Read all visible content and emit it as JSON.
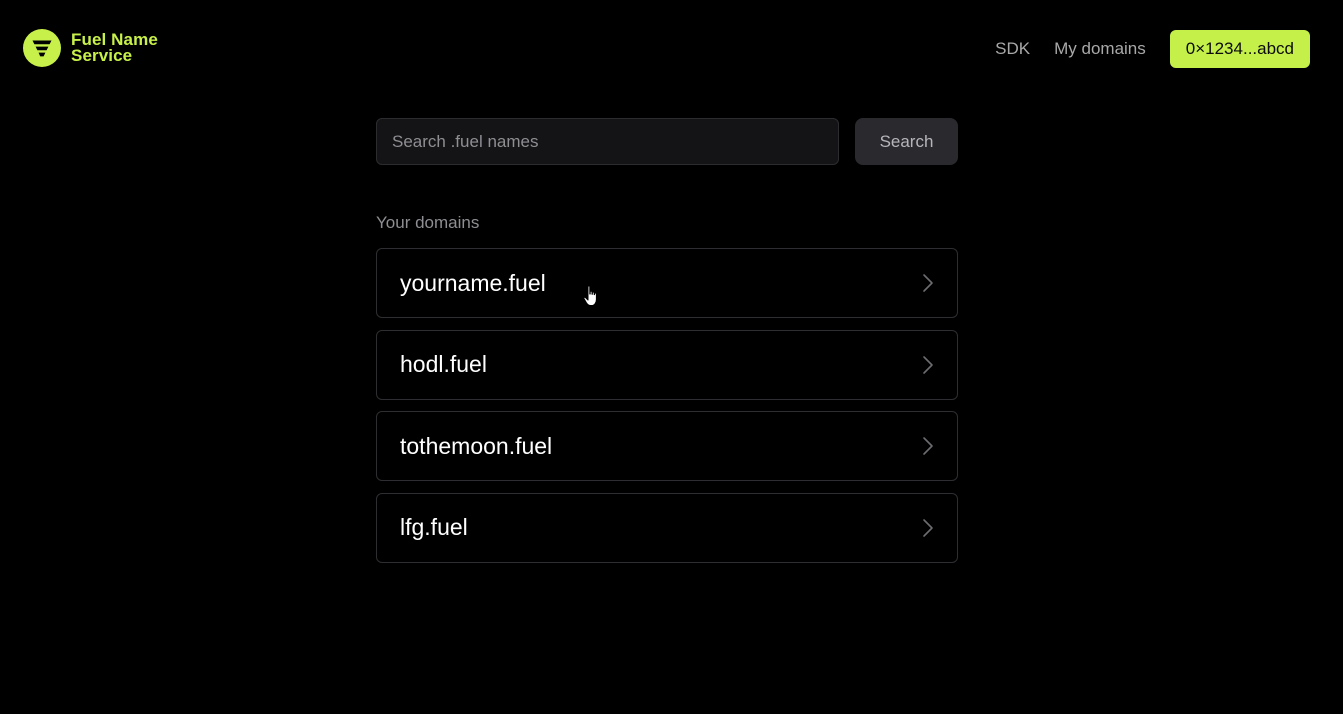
{
  "header": {
    "brand": {
      "line1": "Fuel Name",
      "line2": "Service",
      "logo_icon": "fuel-logo-icon",
      "accent_color": "#c8f04a"
    },
    "nav": {
      "sdk_label": "SDK",
      "my_domains_label": "My domains"
    },
    "wallet": {
      "label": "0×1234...abcd",
      "color": "#c5f04a"
    }
  },
  "search": {
    "placeholder": "Search .fuel names",
    "value": "",
    "button_label": "Search"
  },
  "domains": {
    "section_label": "Your domains",
    "items": [
      {
        "name": "yourname.fuel",
        "icon": "chevron-right-icon"
      },
      {
        "name": "hodl.fuel",
        "icon": "chevron-right-icon"
      },
      {
        "name": "tothemoon.fuel",
        "icon": "chevron-right-icon"
      },
      {
        "name": "lfg.fuel",
        "icon": "chevron-right-icon"
      }
    ]
  },
  "cursor": {
    "icon": "hand-pointer-cursor-icon"
  }
}
